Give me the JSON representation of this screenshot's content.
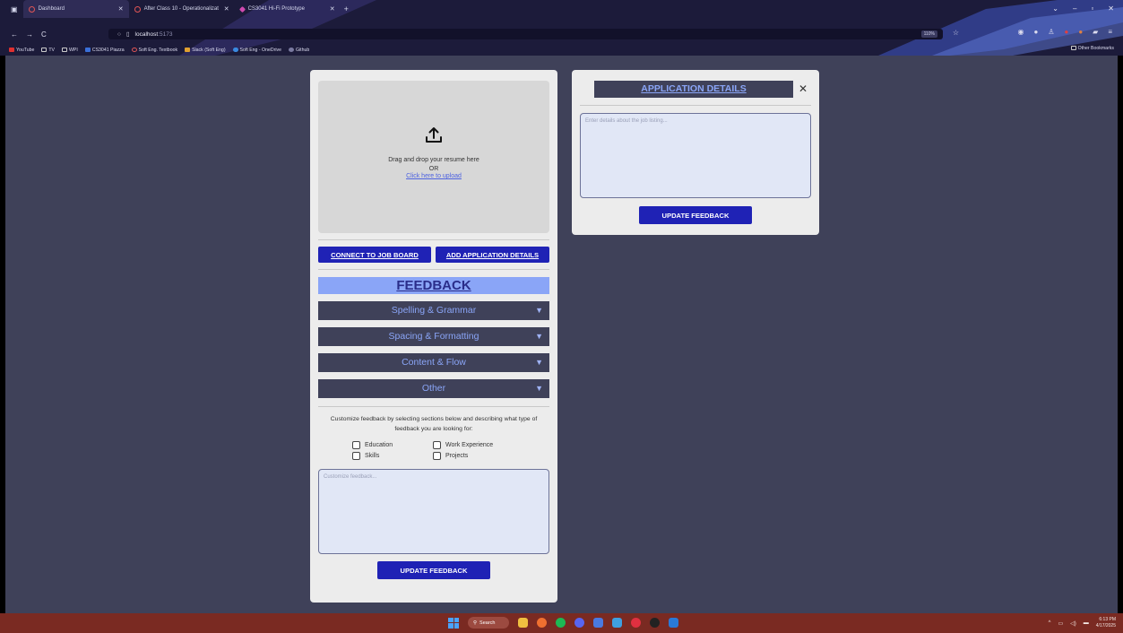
{
  "browser": {
    "tabs": [
      {
        "label": "Dashboard",
        "active": true
      },
      {
        "label": "After Class 10 - Operationalizat",
        "active": false
      },
      {
        "label": "CS3041 Hi-Fi Prototype",
        "active": false
      }
    ],
    "new_tab_glyph": "+",
    "window_controls": [
      "⌄",
      "–",
      "▫",
      "✕"
    ],
    "nav_glyphs": {
      "back": "←",
      "forward": "→",
      "reload": "C"
    },
    "url_host": "localhost",
    "url_port": ":5173",
    "zoom": "110%",
    "bookmarks": [
      {
        "label": "YouTube",
        "color": "#e03030"
      },
      {
        "label": "TV",
        "color": "transparent"
      },
      {
        "label": "WPI",
        "color": "transparent"
      },
      {
        "label": "CS3041 Piazza",
        "color": "#3a6fd8"
      },
      {
        "label": "Soft Eng. Textbook",
        "color": "#e05555"
      },
      {
        "label": "Slack (Soft Eng)",
        "color": "#e0a030"
      },
      {
        "label": "Soft Eng - OneDrive",
        "color": "#3a8ae0"
      },
      {
        "label": "Github",
        "color": "#7a7aa0"
      }
    ],
    "other_bookmarks": "Other Bookmarks"
  },
  "upload": {
    "line1": "Drag and drop your resume here",
    "line2": "OR",
    "link": "Click here to upload"
  },
  "buttons": {
    "connect": "CONNECT TO JOB BOARD",
    "add_details": "ADD APPLICATION DETAILS",
    "update": "UPDATE FEEDBACK"
  },
  "feedback": {
    "title": "FEEDBACK",
    "sections": [
      "Spelling & Grammar",
      "Spacing & Formatting",
      "Content & Flow",
      "Other"
    ],
    "arrow": "▼",
    "customize_text": "Customize feedback by selecting sections below and describing what type of feedback you are looking for:",
    "options": [
      "Education",
      "Work Experience",
      "Skills",
      "Projects"
    ],
    "placeholder": "Customize feedback..."
  },
  "application_details": {
    "title": "APPLICATION DETAILS",
    "close": "✕",
    "placeholder": "Enter details about the job listing..."
  },
  "taskbar": {
    "search": "Search",
    "time": "6:13 PM",
    "date": "4/17/2025",
    "tray": "^"
  },
  "colors": {
    "page_bg": "#3f4159",
    "accent_blue": "#1f22b5",
    "feedback_header": "#8aa5f7",
    "taskbar": "#7a2a22"
  }
}
